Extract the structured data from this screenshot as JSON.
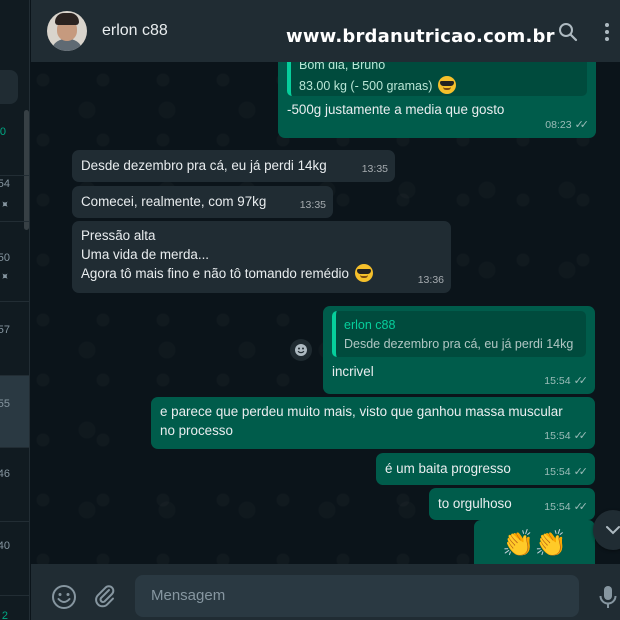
{
  "sidebar": {
    "rows": [
      {
        "time": "0",
        "pinned": false,
        "active": false,
        "green": true
      },
      {
        "time": "54",
        "pinned": true,
        "active": false,
        "green": false
      },
      {
        "time": "50",
        "pinned": true,
        "active": false,
        "green": false
      },
      {
        "time": "57",
        "pinned": false,
        "active": false,
        "green": false
      },
      {
        "time": "55",
        "pinned": false,
        "active": true,
        "green": false
      },
      {
        "time": "46",
        "pinned": false,
        "active": false,
        "green": false
      },
      {
        "time": "40",
        "pinned": false,
        "active": false,
        "green": false
      },
      {
        "time": "2",
        "pinned": false,
        "active": false,
        "green": true
      }
    ]
  },
  "header": {
    "contact_name": "erlon c88",
    "watermark": "www.brdanutricao.com.br",
    "search_icon": "search-icon",
    "menu_icon": "kebab-menu-icon"
  },
  "messages": [
    {
      "dir": "out",
      "quote_line1": "Bom dia, Bruno",
      "quote_line2": "83.00 kg (- 500 gramas)",
      "emoji": "sunglasses-emoji",
      "text": "-500g justamente a media que gosto",
      "time": "08:23",
      "ticks": "read"
    },
    {
      "dir": "in",
      "text": "Desde dezembro pra cá, eu já perdi 14kg",
      "time": "13:35"
    },
    {
      "dir": "in",
      "text": "Comecei, realmente, com 97kg",
      "time": "13:35"
    },
    {
      "dir": "in",
      "lines": [
        "Pressão alta",
        "Uma vida de merda...",
        "Agora tô mais fino e não tô tomando remédio"
      ],
      "emoji": "sunglasses-emoji",
      "time": "13:36"
    },
    {
      "dir": "out",
      "quote_name": "erlon c88",
      "quote_text": "Desde dezembro pra cá, eu já perdi 14kg",
      "text": "incrivel",
      "time": "15:54",
      "ticks": "read"
    },
    {
      "dir": "out",
      "lines": [
        "e parece que perdeu muito mais, visto que ganhou massa muscular",
        "no processo"
      ],
      "time": "15:54",
      "ticks": "read"
    },
    {
      "dir": "out",
      "text": "é um baita progresso",
      "time": "15:54",
      "ticks": "read"
    },
    {
      "dir": "out",
      "text": "to orgulhoso",
      "time": "15:54",
      "ticks": "read"
    },
    {
      "dir": "out",
      "emoji_content": "clapping-hands-emoji x2",
      "clap_glyphs": "👏👏"
    }
  ],
  "footer": {
    "placeholder": "Mensagem",
    "emoji_icon": "emoji-icon",
    "attach_icon": "paperclip-icon",
    "mic_icon": "microphone-icon"
  },
  "colors": {
    "bg": "#0b141a",
    "panel": "#202c33",
    "incoming": "#202c33",
    "outgoing": "#005c4b",
    "accent": "#06cf9c"
  }
}
